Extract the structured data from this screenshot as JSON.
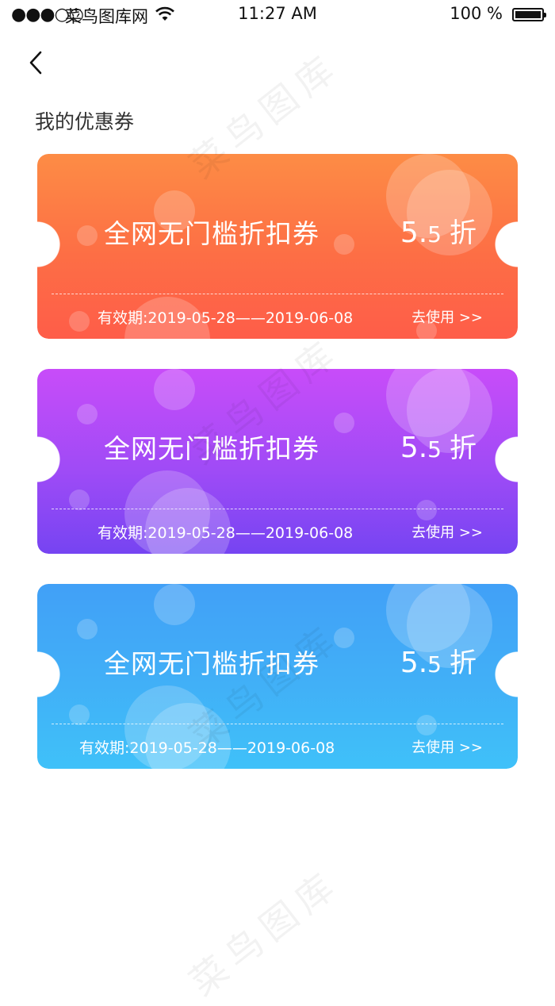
{
  "status_bar": {
    "signal": "●●●○○",
    "carrier": "菜鸟图库网",
    "time": "11:27 AM",
    "battery_percent": "100 %"
  },
  "page": {
    "title": "我的优惠券",
    "watermark": "菜鸟图库"
  },
  "coupons": [
    {
      "name": "全网无门槛折扣券",
      "discount_int": "5.",
      "discount_dec": "5",
      "discount_unit": "折",
      "validity": "有效期:2019-05-28——2019-06-08",
      "action": "去使用 >>",
      "color_top": "#fd8c45",
      "color_bottom": "#fe5d49"
    },
    {
      "name": "全网无门槛折扣券",
      "discount_int": "5.",
      "discount_dec": "5",
      "discount_unit": "折",
      "validity": "有效期:2019-05-28——2019-06-08",
      "action": "去使用 >>",
      "color_top": "#c84cf9",
      "color_bottom": "#7644f2"
    },
    {
      "name": "全网无门槛折扣券",
      "discount_int": "5.",
      "discount_dec": "5",
      "discount_unit": "折",
      "validity": "有效期:2019-05-28——2019-06-08",
      "action": "去使用 >>",
      "color_top": "#41a0f7",
      "color_bottom": "#3fc1f9"
    }
  ]
}
